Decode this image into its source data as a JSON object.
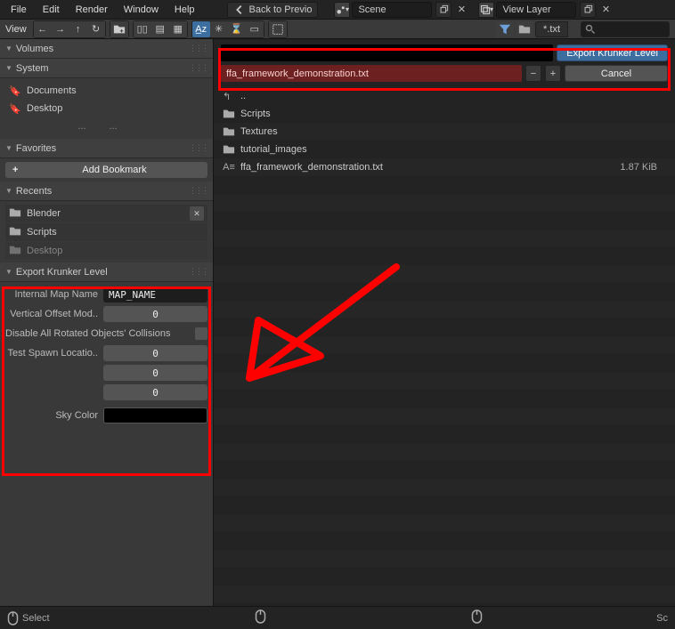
{
  "menubar": {
    "items": [
      "File",
      "Edit",
      "Render",
      "Window",
      "Help"
    ]
  },
  "header": {
    "back_btn": "Back to Previo",
    "scene_field": "Scene",
    "viewlayer_field": "View Layer"
  },
  "toolbar": {
    "view_label": "View",
    "filter_label": "*.txt"
  },
  "sidebar": {
    "volumes": {
      "title": "Volumes"
    },
    "system": {
      "title": "System",
      "items": [
        "Documents",
        "Desktop"
      ],
      "more": "..."
    },
    "favorites": {
      "title": "Favorites"
    },
    "bookmark_btn": "Add Bookmark",
    "recents": {
      "title": "Recents",
      "items": [
        "Blender",
        "Scripts",
        "Desktop"
      ]
    },
    "export_panel": {
      "title": "Export Krunker Level",
      "map_name_label": "Internal Map Name",
      "map_name_value": "MAP_NAME",
      "vert_offset_label": "Vertical Offset Mod..",
      "vert_offset_value": "0",
      "disable_coll_label": "Disable All Rotated Objects' Collisions",
      "spawn_label": "Test Spawn Locatio..",
      "spawn_values": [
        "0",
        "0",
        "0"
      ],
      "sky_label": "Sky Color"
    }
  },
  "actions": {
    "export_btn": "Export Krunker Level",
    "filename": "ffa_framework_demonstration.txt",
    "cancel_btn": "Cancel"
  },
  "files": {
    "up": "..",
    "dirs": [
      "Scripts",
      "Textures",
      "tutorial_images"
    ],
    "file": {
      "name": "ffa_framework_demonstration.txt",
      "size": "1.87 KiB"
    }
  },
  "statusbar": {
    "select": "Select",
    "right": "Sc"
  }
}
